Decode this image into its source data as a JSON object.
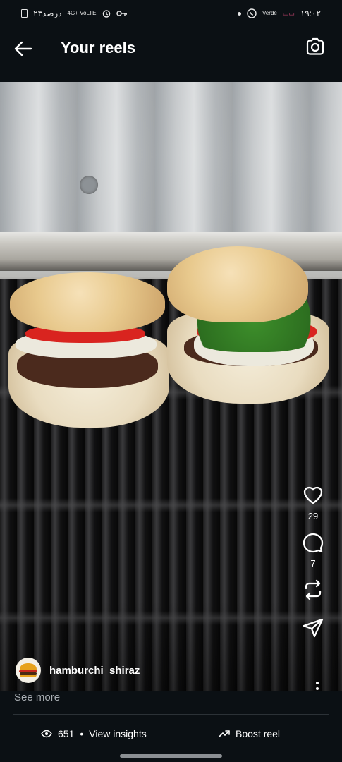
{
  "status_bar": {
    "battery_text": "۲۳درصد",
    "network": "4G+ VoLTE",
    "carrier": "Verde",
    "time": "۱۹:۰۲"
  },
  "header": {
    "title": "Your reels",
    "back_icon": "arrow-left-icon",
    "camera_icon": "camera-icon"
  },
  "reel": {
    "author": "hamburchi_shiraz",
    "likes": "29",
    "comments": "7"
  },
  "bottom": {
    "see_more": "See more",
    "views": "651",
    "insights_label": "View insights",
    "boost_label": "Boost reel"
  },
  "colors": {
    "background": "#000000",
    "bar": "#0b1014",
    "text": "#ffffff",
    "muted": "#a8adb2"
  }
}
